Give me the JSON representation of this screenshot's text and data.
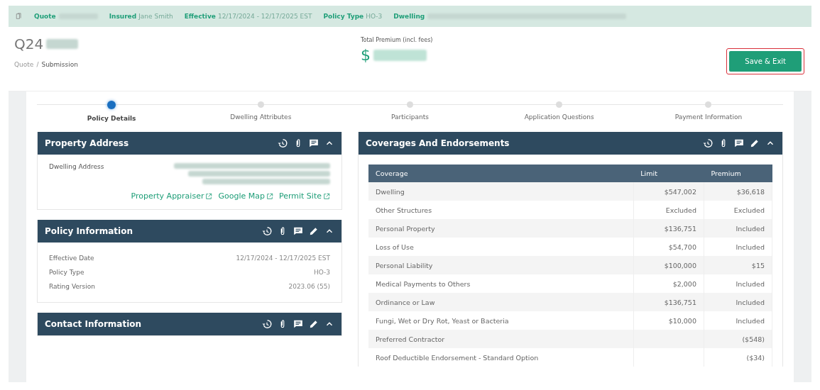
{
  "summary_bar": {
    "items": [
      {
        "label": "Quote",
        "redacted": true
      },
      {
        "label": "Insured",
        "value": "Jane Smith",
        "redacted": false
      },
      {
        "label": "Effective",
        "value": "12/17/2024 - 12/17/2025 EST",
        "redacted": false
      },
      {
        "label": "Policy Type",
        "value": "HO-3",
        "redacted": false
      },
      {
        "label": "Dwelling",
        "redacted": true
      }
    ]
  },
  "header": {
    "quote_number": "Q24",
    "breadcrumb_separator": "/",
    "breadcrumb": [
      {
        "label": "Quote",
        "current": false
      },
      {
        "label": "Submission",
        "current": true
      }
    ],
    "premium_label": "Total Premium (incl. fees)",
    "premium_currency": "$",
    "save_button": {
      "label": "Save & Exit",
      "highlighted": true
    }
  },
  "steps": [
    {
      "label": "Policy Details",
      "selected": true
    },
    {
      "label": "Dwelling Attributes",
      "selected": false
    },
    {
      "label": "Participants",
      "selected": false
    },
    {
      "label": "Application Questions",
      "selected": false
    },
    {
      "label": "Payment Information",
      "selected": false
    }
  ],
  "left_panels": [
    {
      "title": "Property Address",
      "editable": false,
      "expanded": true,
      "kind": "address",
      "field_label": "Dwelling Address",
      "links": [
        "Property Appraiser",
        "Google Map",
        "Permit Site"
      ]
    },
    {
      "title": "Policy Information",
      "editable": true,
      "expanded": true,
      "kind": "fields",
      "fields": [
        {
          "label": "Effective Date",
          "value": "12/17/2024 - 12/17/2025 EST"
        },
        {
          "label": "Policy Type",
          "value": "HO-3"
        },
        {
          "label": "Rating Version",
          "value": "2023.06 (55)"
        }
      ]
    },
    {
      "title": "Contact Information",
      "editable": true,
      "expanded": true,
      "kind": "empty"
    }
  ],
  "coverages": {
    "title": "Coverages And Endorsements",
    "editable": true,
    "expanded": true,
    "columns": [
      "Coverage",
      "Limit",
      "Premium"
    ],
    "rows": [
      [
        "Dwelling",
        "$547,002",
        "$36,618"
      ],
      [
        "Other Structures",
        "Excluded",
        "Excluded"
      ],
      [
        "Personal Property",
        "$136,751",
        "Included"
      ],
      [
        "Loss of Use",
        "$54,700",
        "Included"
      ],
      [
        "Personal Liability",
        "$100,000",
        "$15"
      ],
      [
        "Medical Payments to Others",
        "$2,000",
        "Included"
      ],
      [
        "Ordinance or Law",
        "$136,751",
        "Included"
      ],
      [
        "Fungi, Wet or Dry Rot, Yeast or Bacteria",
        "$10,000",
        "Included"
      ],
      [
        "Preferred Contractor",
        "",
        "($548)"
      ],
      [
        "Roof Deductible Endorsement - Standard Option",
        "",
        "($34)"
      ]
    ]
  }
}
